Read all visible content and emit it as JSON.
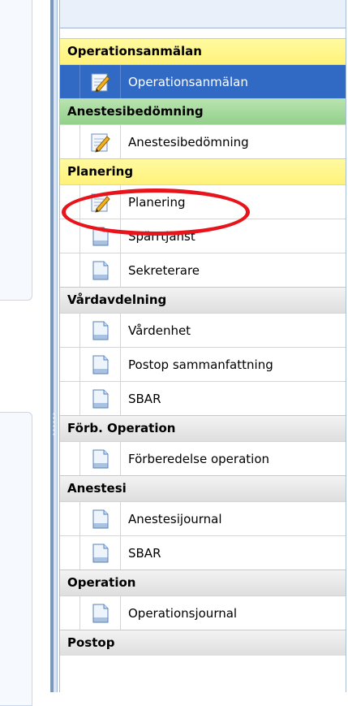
{
  "navigation": {
    "groups": [
      {
        "header": "Operationsanmälan",
        "color": "#fff27a",
        "items": [
          {
            "label": "Operationsanmälan",
            "icon": "edit-form-icon",
            "selected": true
          }
        ]
      },
      {
        "header": "Anestesibedömning",
        "color": "#93d08a",
        "items": [
          {
            "label": "Anestesibedömning",
            "icon": "edit-form-icon"
          }
        ]
      },
      {
        "header": "Planering",
        "color": "#fff27a",
        "items": [
          {
            "label": "Planering",
            "icon": "edit-form-icon",
            "highlighted": true
          },
          {
            "label": "Spärrtjänst",
            "icon": "document-icon"
          },
          {
            "label": "Sekreterare",
            "icon": "document-icon"
          }
        ]
      },
      {
        "header": "Vårdavdelning",
        "color": "#dedede",
        "items": [
          {
            "label": "Vårdenhet",
            "icon": "document-icon"
          },
          {
            "label": "Postop sammanfattning",
            "icon": "document-icon"
          },
          {
            "label": "SBAR",
            "icon": "document-icon"
          }
        ]
      },
      {
        "header": "Förb. Operation",
        "color": "#dedede",
        "items": [
          {
            "label": "Förberedelse operation",
            "icon": "document-icon"
          }
        ]
      },
      {
        "header": "Anestesi",
        "color": "#dedede",
        "items": [
          {
            "label": "Anestesijournal",
            "icon": "document-icon"
          },
          {
            "label": "SBAR",
            "icon": "document-icon"
          }
        ]
      },
      {
        "header": "Operation",
        "color": "#dedede",
        "items": [
          {
            "label": "Operationsjournal",
            "icon": "document-icon"
          }
        ]
      },
      {
        "header": "Postop",
        "color": "#dedede",
        "items": []
      }
    ]
  },
  "annotation": {
    "color": "#e8141b",
    "target": "Planering"
  }
}
